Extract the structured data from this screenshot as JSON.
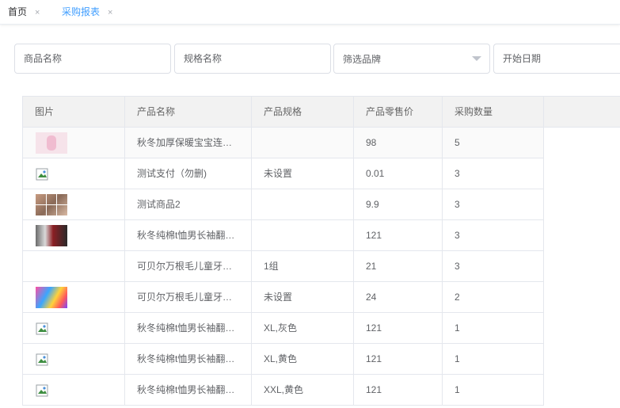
{
  "tabs": [
    {
      "label": "首页",
      "active": false
    },
    {
      "label": "采购报表",
      "active": true
    }
  ],
  "tab_close_glyph": "×",
  "filters": {
    "product_name_placeholder": "商品名称",
    "spec_name_placeholder": "规格名称",
    "brand_select_text": "筛选品牌",
    "start_date_placeholder": "开始日期"
  },
  "table": {
    "headers": [
      "图片",
      "产品名称",
      "产品规格",
      "产品零售价",
      "采购数量"
    ],
    "rows": [
      {
        "image": "pink-clothing-thumb",
        "name": "秋冬加厚保暖宝宝连…",
        "spec": "",
        "price": "98",
        "qty": "5"
      },
      {
        "image": "broken-image-icon",
        "name": "测试支付（勿删)",
        "spec": "未设置",
        "price": "0.01",
        "qty": "3"
      },
      {
        "image": "photo-grid-thumb",
        "name": "测试商品2",
        "spec": "",
        "price": "9.9",
        "qty": "3"
      },
      {
        "image": "dark-clothing-thumb",
        "name": "秋冬纯棉t恤男长袖翻…",
        "spec": "",
        "price": "121",
        "qty": "3"
      },
      {
        "image": "",
        "name": "可贝尔万根毛儿童牙…",
        "spec": "1组",
        "price": "21",
        "qty": "3"
      },
      {
        "image": "colorful-product-thumb",
        "name": "可贝尔万根毛儿童牙…",
        "spec": "未设置",
        "price": "24",
        "qty": "2"
      },
      {
        "image": "broken-image-icon",
        "name": "秋冬纯棉t恤男长袖翻…",
        "spec": "XL,灰色",
        "price": "121",
        "qty": "1"
      },
      {
        "image": "broken-image-icon",
        "name": "秋冬纯棉t恤男长袖翻…",
        "spec": "XL,黄色",
        "price": "121",
        "qty": "1"
      },
      {
        "image": "broken-image-icon",
        "name": "秋冬纯棉t恤男长袖翻…",
        "spec": "XXL,黄色",
        "price": "121",
        "qty": "1"
      }
    ]
  },
  "colors": {
    "accent": "#409eff",
    "header_bg": "#f2f2f2",
    "border": "#e4e7ed"
  }
}
